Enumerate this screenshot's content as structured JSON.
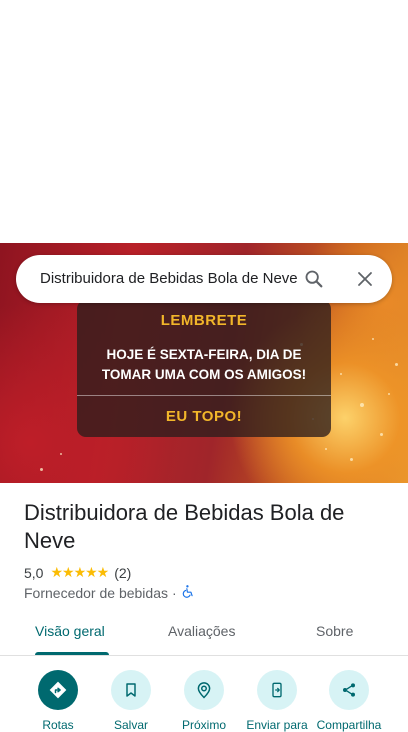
{
  "search": {
    "value": "Distribuidora de Bebidas Bola de Neve"
  },
  "photo_notice": {
    "title": "LEMBRETE",
    "body": "HOJE É SEXTA-FEIRA, DIA DE TOMAR UMA COM OS AMIGOS!",
    "cta": "EU TOPO!"
  },
  "place": {
    "name": "Distribuidora de Bebidas Bola de Neve",
    "rating": "5,0",
    "stars": "★★★★★",
    "review_count": "(2)",
    "category": "Fornecedor de bebidas",
    "separator": "·"
  },
  "tabs": [
    {
      "label": "Visão geral",
      "active": true
    },
    {
      "label": "Avaliações",
      "active": false
    },
    {
      "label": "Sobre",
      "active": false
    }
  ],
  "actions": [
    {
      "label": "Rotas",
      "icon": "directions-icon"
    },
    {
      "label": "Salvar",
      "icon": "bookmark-icon"
    },
    {
      "label": "Próximo",
      "icon": "nearby-icon"
    },
    {
      "label": "Enviar para",
      "icon": "send-to-phone-icon"
    },
    {
      "label": "Compartilha",
      "icon": "share-icon"
    }
  ],
  "colors": {
    "accent": "#00696f",
    "accent_light": "#d7f3f5",
    "star": "#fbbc04",
    "notice_text": "#f2b62a",
    "accessibility": "#1a73e8"
  }
}
